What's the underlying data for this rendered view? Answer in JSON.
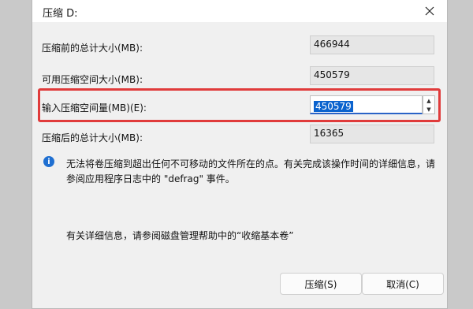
{
  "dialog": {
    "title": "压缩 D:",
    "fields": [
      {
        "label": "压缩前的总计大小(MB):",
        "value": "466944"
      },
      {
        "label": "可用压缩空间大小(MB):",
        "value": "450579"
      },
      {
        "label": "输入压缩空间量(MB)(E):",
        "value": "450579"
      },
      {
        "label": "压缩后的总计大小(MB):",
        "value": "16365"
      }
    ],
    "info_text": "无法将卷压缩到超出任何不可移动的文件所在的点。有关完成该操作时间的详细信息，请参阅应用程序日志中的 \"defrag\" 事件。",
    "more_info": "有关详细信息，请参阅磁盘管理帮助中的“收缩基本卷”",
    "buttons": {
      "shrink": "压缩(S)",
      "cancel": "取消(C)"
    },
    "colors": {
      "highlight": "#e03b3b",
      "selection": "#0b63ce",
      "info_icon": "#1f6fd1"
    },
    "icons": {
      "close": "close-icon",
      "info": "info-icon",
      "spin_up": "spin-up-icon",
      "spin_down": "spin-down-icon"
    }
  }
}
